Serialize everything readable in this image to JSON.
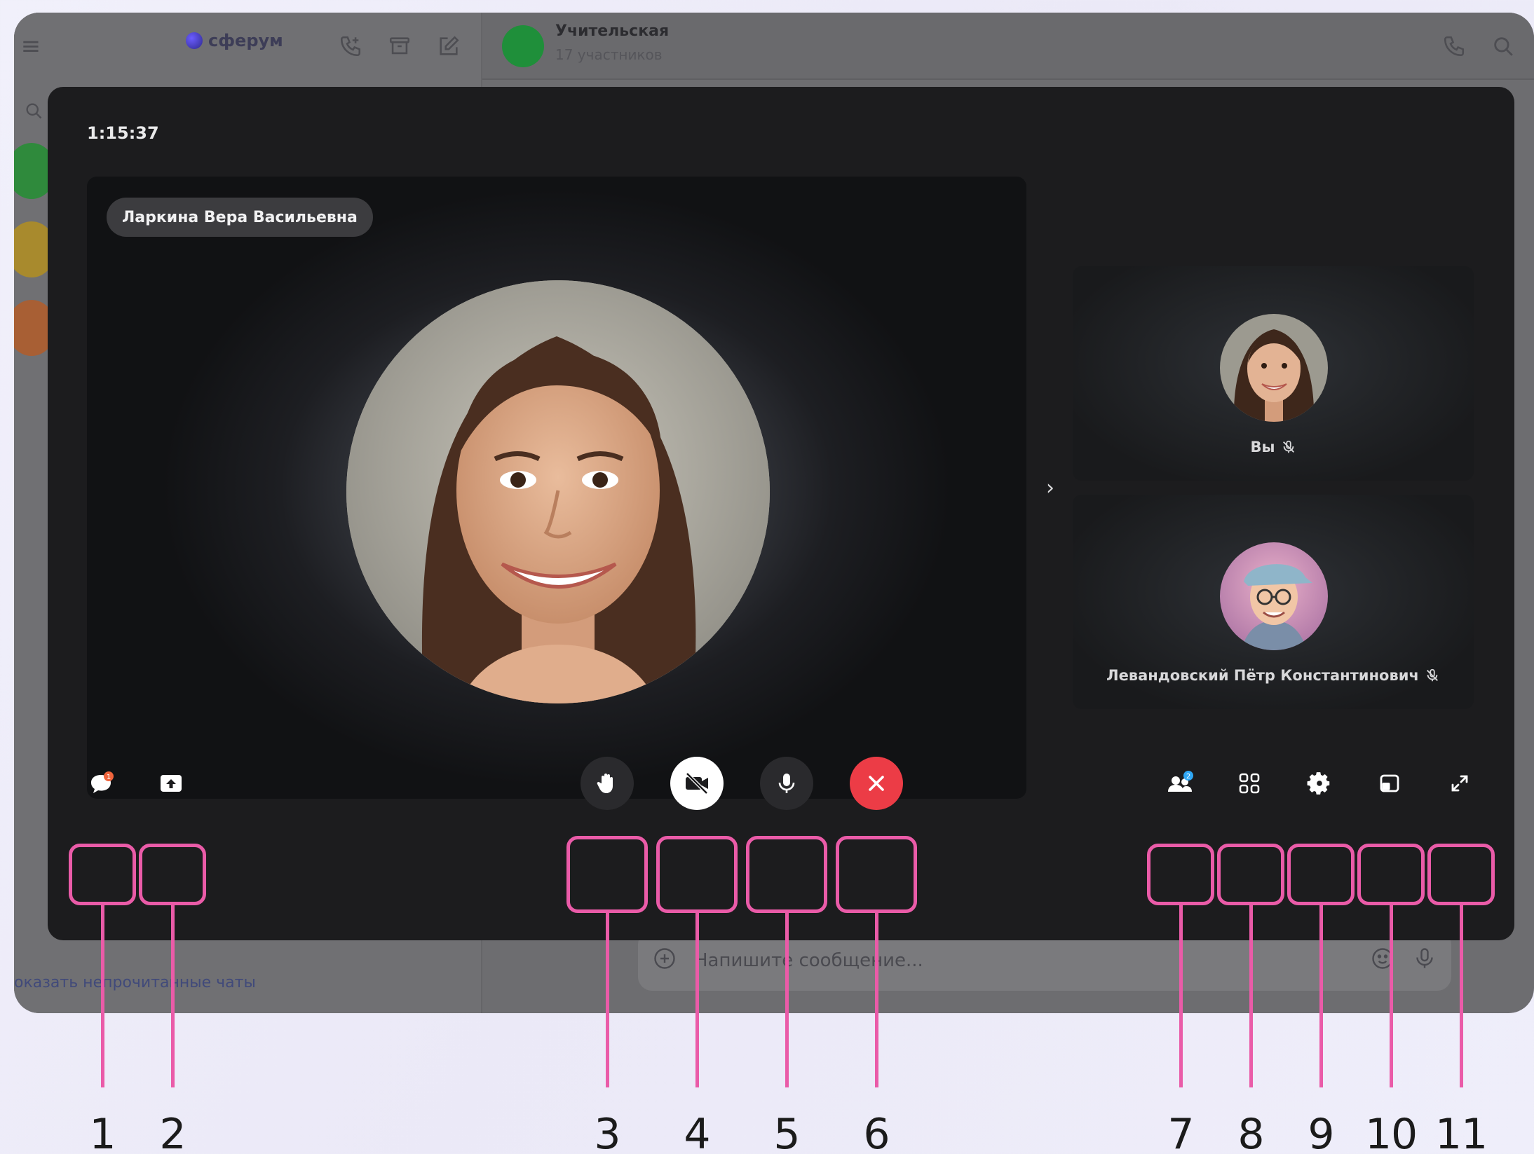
{
  "app": {
    "brand": "сферум",
    "chat_title": "Учительская",
    "chat_subtitle": "17 участников",
    "unread_link": "оказать непрочитанные чаты",
    "compose_placeholder": "Напишите сообщение..."
  },
  "call": {
    "timer": "1:15:37",
    "main_speaker": "Ларкина Вера Васильевна",
    "participants": [
      {
        "label": "Вы",
        "muted": true
      },
      {
        "label": "Левандовский Пётр Константинович",
        "muted": true
      }
    ],
    "chat_badge_count": "1",
    "participants_badge_count": "2",
    "controls": {
      "chat": "chat-icon",
      "share_screen": "share-screen-icon",
      "raise_hand": "raise-hand-icon",
      "camera": "camera-off-icon",
      "microphone": "microphone-icon",
      "end_call": "close-icon",
      "participants": "participants-icon",
      "layout": "grid-icon",
      "settings": "gear-icon",
      "picture_in_picture": "pip-icon",
      "fullscreen": "fullscreen-icon"
    }
  },
  "callouts": [
    "1",
    "2",
    "3",
    "4",
    "5",
    "6",
    "7",
    "8",
    "9",
    "10",
    "11"
  ],
  "colors": {
    "accent_pink": "#ea5ba8",
    "end_call_red": "#ec3c46",
    "overlay_bg": "#1c1c1e",
    "badge_orange": "#f0643c",
    "badge_blue": "#2fa7f5"
  }
}
